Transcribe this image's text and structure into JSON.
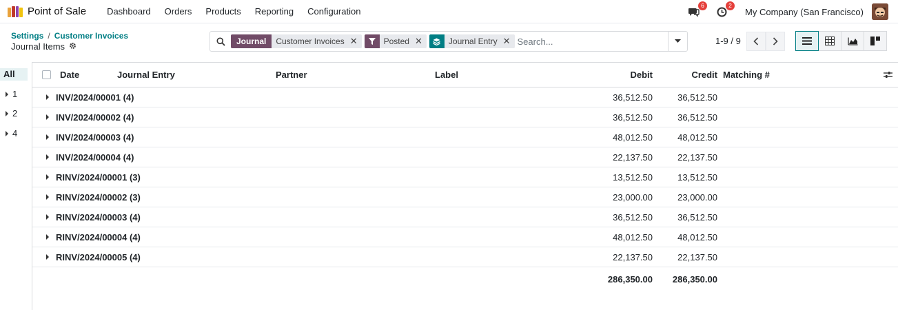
{
  "navbar": {
    "app_name": "Point of Sale",
    "app_icon_colors": [
      "#e9a23b",
      "#c0392b",
      "#8e44ad",
      "#f1c40f"
    ],
    "menu": [
      "Dashboard",
      "Orders",
      "Products",
      "Reporting",
      "Configuration"
    ],
    "messages_badge": "6",
    "activities_badge": "2",
    "company": "My Company (San Francisco)"
  },
  "breadcrumb": {
    "items": [
      "Settings",
      "Customer Invoices"
    ],
    "separator": "/",
    "current": "Journal Items"
  },
  "search": {
    "facets": [
      {
        "type": "group",
        "label": "Journal",
        "value": "Customer Invoices",
        "color": "#714b67"
      },
      {
        "type": "filter",
        "icon": "filter-icon",
        "value": "Posted",
        "color": "#714b67"
      },
      {
        "type": "groupby",
        "icon": "layers-icon",
        "value": "Journal Entry",
        "color": "#017e84"
      }
    ],
    "placeholder": "Search..."
  },
  "pager": {
    "text": "1-9 / 9"
  },
  "views": [
    "list-view",
    "pivot-view",
    "graph-view",
    "kanban-view"
  ],
  "active_view": "list-view",
  "side_panel": {
    "all_label": "All",
    "items": [
      "1",
      "2",
      "4"
    ]
  },
  "table": {
    "headers": {
      "date": "Date",
      "journal_entry": "Journal Entry",
      "partner": "Partner",
      "label": "Label",
      "debit": "Debit",
      "credit": "Credit",
      "matching": "Matching #"
    },
    "rows": [
      {
        "name": "INV/2024/00001 (4)",
        "debit": "36,512.50",
        "credit": "36,512.50"
      },
      {
        "name": "INV/2024/00002 (4)",
        "debit": "36,512.50",
        "credit": "36,512.50"
      },
      {
        "name": "INV/2024/00003 (4)",
        "debit": "48,012.50",
        "credit": "48,012.50"
      },
      {
        "name": "INV/2024/00004 (4)",
        "debit": "22,137.50",
        "credit": "22,137.50"
      },
      {
        "name": "RINV/2024/00001 (3)",
        "debit": "13,512.50",
        "credit": "13,512.50"
      },
      {
        "name": "RINV/2024/00002 (3)",
        "debit": "23,000.00",
        "credit": "23,000.00"
      },
      {
        "name": "RINV/2024/00003 (4)",
        "debit": "36,512.50",
        "credit": "36,512.50"
      },
      {
        "name": "RINV/2024/00004 (4)",
        "debit": "48,012.50",
        "credit": "48,012.50"
      },
      {
        "name": "RINV/2024/00005 (4)",
        "debit": "22,137.50",
        "credit": "22,137.50"
      }
    ],
    "totals": {
      "debit": "286,350.00",
      "credit": "286,350.00"
    }
  }
}
